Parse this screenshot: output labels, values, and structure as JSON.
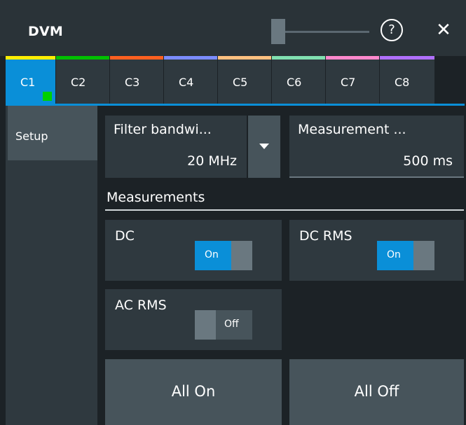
{
  "window": {
    "title": "DVM"
  },
  "tabs": [
    {
      "label": "C1",
      "color": "#ffee00",
      "active": true
    },
    {
      "label": "C2",
      "color": "#00c000"
    },
    {
      "label": "C3",
      "color": "#ff6020"
    },
    {
      "label": "C4",
      "color": "#7b8cff"
    },
    {
      "label": "C5",
      "color": "#ffc080"
    },
    {
      "label": "C6",
      "color": "#80e0b0"
    },
    {
      "label": "C7",
      "color": "#ff88cc"
    },
    {
      "label": "C8",
      "color": "#b070ff"
    }
  ],
  "sidebar": {
    "items": [
      {
        "label": "Setup"
      }
    ]
  },
  "settings": {
    "filter_bandwidth": {
      "label": "Filter bandwi...",
      "value": "20 MHz"
    },
    "measurement_time": {
      "label": "Measurement ...",
      "value": "500 ms"
    }
  },
  "measurements": {
    "title": "Measurements",
    "dc": {
      "label": "DC",
      "state": "On"
    },
    "dc_rms": {
      "label": "DC RMS",
      "state": "On"
    },
    "ac_rms": {
      "label": "AC RMS",
      "state": "Off"
    }
  },
  "buttons": {
    "all_on": "All On",
    "all_off": "All Off"
  },
  "colors": {
    "accent": "#0a8fd8",
    "active_indicator": "#00d000"
  },
  "icons": {
    "help": "help-circle-icon",
    "close": "close-icon",
    "dropdown": "caret-down-icon"
  }
}
